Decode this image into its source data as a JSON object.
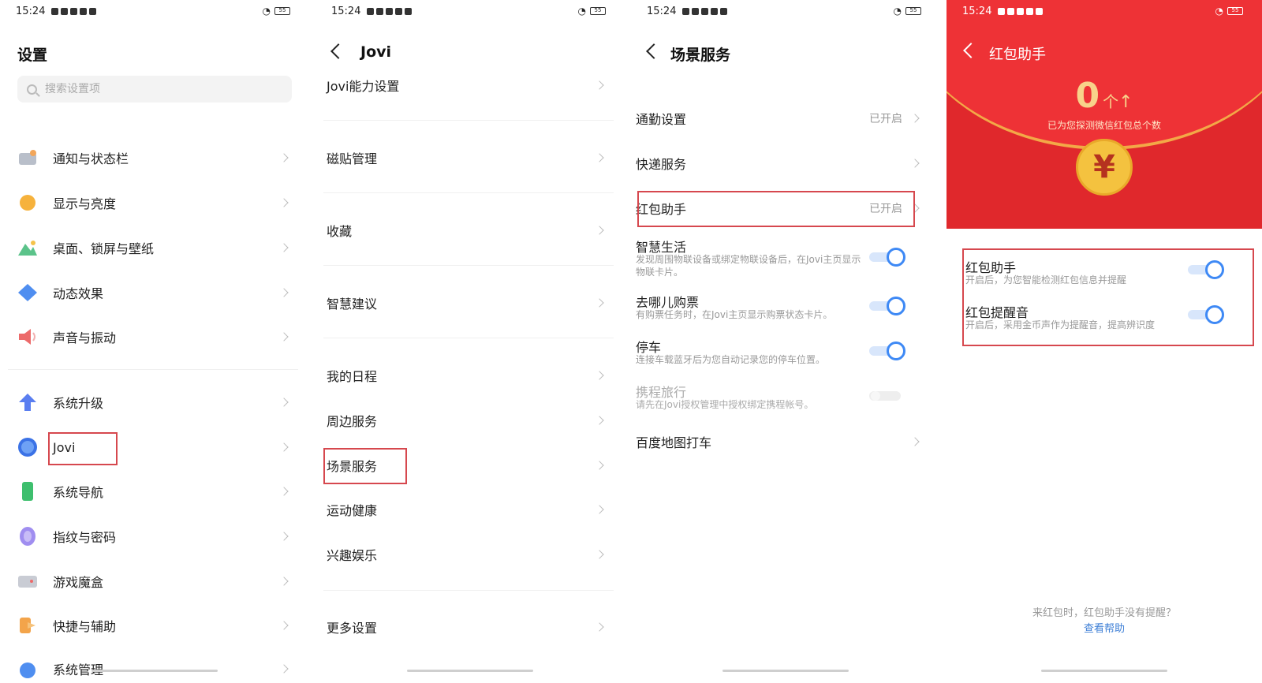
{
  "status_bar": {
    "time": "15:24",
    "battery": "55"
  },
  "settings": {
    "title": "设置",
    "search_placeholder": "搜索设置项",
    "items": [
      {
        "label": "通知与状态栏",
        "icon": "notification-icon"
      },
      {
        "label": "显示与亮度",
        "icon": "brightness-icon"
      },
      {
        "label": "桌面、锁屏与壁纸",
        "icon": "wallpaper-icon"
      },
      {
        "label": "动态效果",
        "icon": "effects-icon"
      },
      {
        "label": "声音与振动",
        "icon": "speaker-icon"
      },
      {
        "label": "系统升级",
        "icon": "upgrade-icon"
      },
      {
        "label": "Jovi",
        "icon": "jovi-icon"
      },
      {
        "label": "系统导航",
        "icon": "navigation-icon"
      },
      {
        "label": "指纹与密码",
        "icon": "fingerprint-icon"
      },
      {
        "label": "游戏魔盒",
        "icon": "gamebox-icon"
      },
      {
        "label": "快捷与辅助",
        "icon": "shortcut-icon"
      },
      {
        "label": "系统管理",
        "icon": "system-icon"
      }
    ]
  },
  "jovi": {
    "title": "Jovi",
    "items": [
      {
        "label": "Jovi能力设置"
      },
      {
        "label": "磁贴管理"
      },
      {
        "label": "收藏"
      },
      {
        "label": "智慧建议"
      },
      {
        "label": "我的日程"
      },
      {
        "label": "周边服务"
      },
      {
        "label": "场景服务"
      },
      {
        "label": "运动健康"
      },
      {
        "label": "兴趣娱乐"
      },
      {
        "label": "更多设置"
      }
    ]
  },
  "scene": {
    "title": "场景服务",
    "nav_items": [
      {
        "label": "通勤设置",
        "status": "已开启"
      },
      {
        "label": "快递服务",
        "status": ""
      },
      {
        "label": "红包助手",
        "status": "已开启"
      }
    ],
    "toggles": [
      {
        "label": "智慧生活",
        "desc": "发现周围物联设备或绑定物联设备后，在Jovi主页显示物联卡片。",
        "on": true
      },
      {
        "label": "去哪儿购票",
        "desc": "有购票任务时，在Jovi主页显示购票状态卡片。",
        "on": true
      },
      {
        "label": "停车",
        "desc": "连接车载蓝牙后为您自动记录您的停车位置。",
        "on": true
      },
      {
        "label": "携程旅行",
        "desc": "请先在Jovi授权管理中授权绑定携程帐号。",
        "on": false
      }
    ],
    "bottom_item": "百度地图打车"
  },
  "redpacket": {
    "title": "红包助手",
    "count": "0",
    "count_unit": "个",
    "count_arrow": "↑",
    "count_desc": "已为您探测微信红包总个数",
    "coin_symbol": "¥",
    "toggles": [
      {
        "label": "红包助手",
        "desc": "开启后，为您智能检测红包信息并提醒",
        "on": true
      },
      {
        "label": "红包提醒音",
        "desc": "开启后，采用金币声作为提醒音，提高辨识度",
        "on": true
      }
    ],
    "help_question": "来红包时，红包助手没有提醒？",
    "help_link": "查看帮助"
  },
  "colors": {
    "accent": "#3e89f5",
    "highlight": "#d6484e",
    "red_header": "#e0282c",
    "gold": "#f4c23f"
  }
}
